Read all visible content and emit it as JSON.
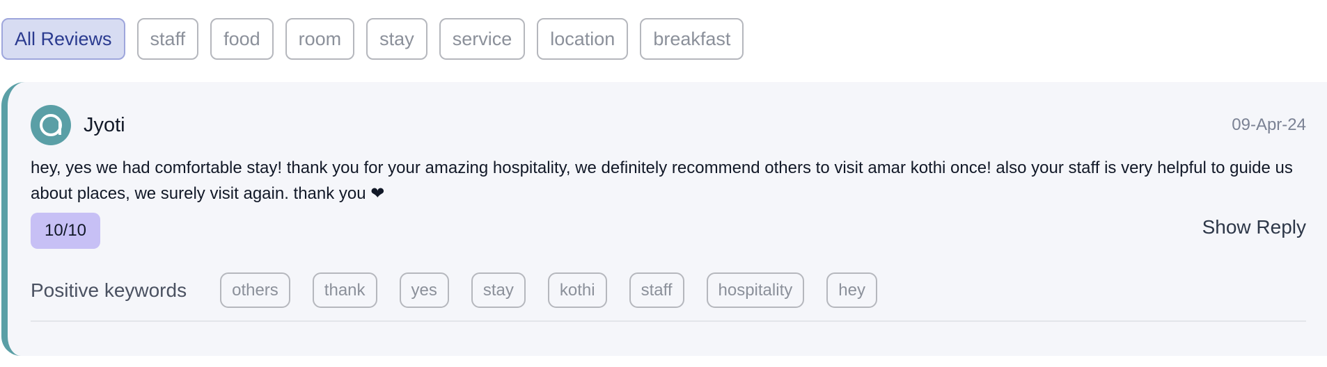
{
  "filters": {
    "tabs": [
      "All Reviews",
      "staff",
      "food",
      "room",
      "stay",
      "service",
      "location",
      "breakfast"
    ],
    "active": "All Reviews"
  },
  "review": {
    "reviewer": "Jyoti",
    "avatar_icon": "letter-a-avatar-icon",
    "date": "09-Apr-24",
    "text": "hey, yes we had comfortable stay! thank you for your amazing hospitality, we definitely recommend others to visit amar kothi once! also your staff is very helpful to guide us about places, we surely visit again. thank you ❤︎",
    "score": "10/10",
    "show_reply_label": "Show Reply",
    "keywords_label": "Positive keywords",
    "keywords": [
      "others",
      "thank",
      "yes",
      "stay",
      "kothi",
      "staff",
      "hospitality",
      "hey"
    ]
  },
  "colors": {
    "accent": "#5a9fa6",
    "active_chip_bg": "#d7dcf2",
    "score_bg": "#c7c0f5"
  }
}
